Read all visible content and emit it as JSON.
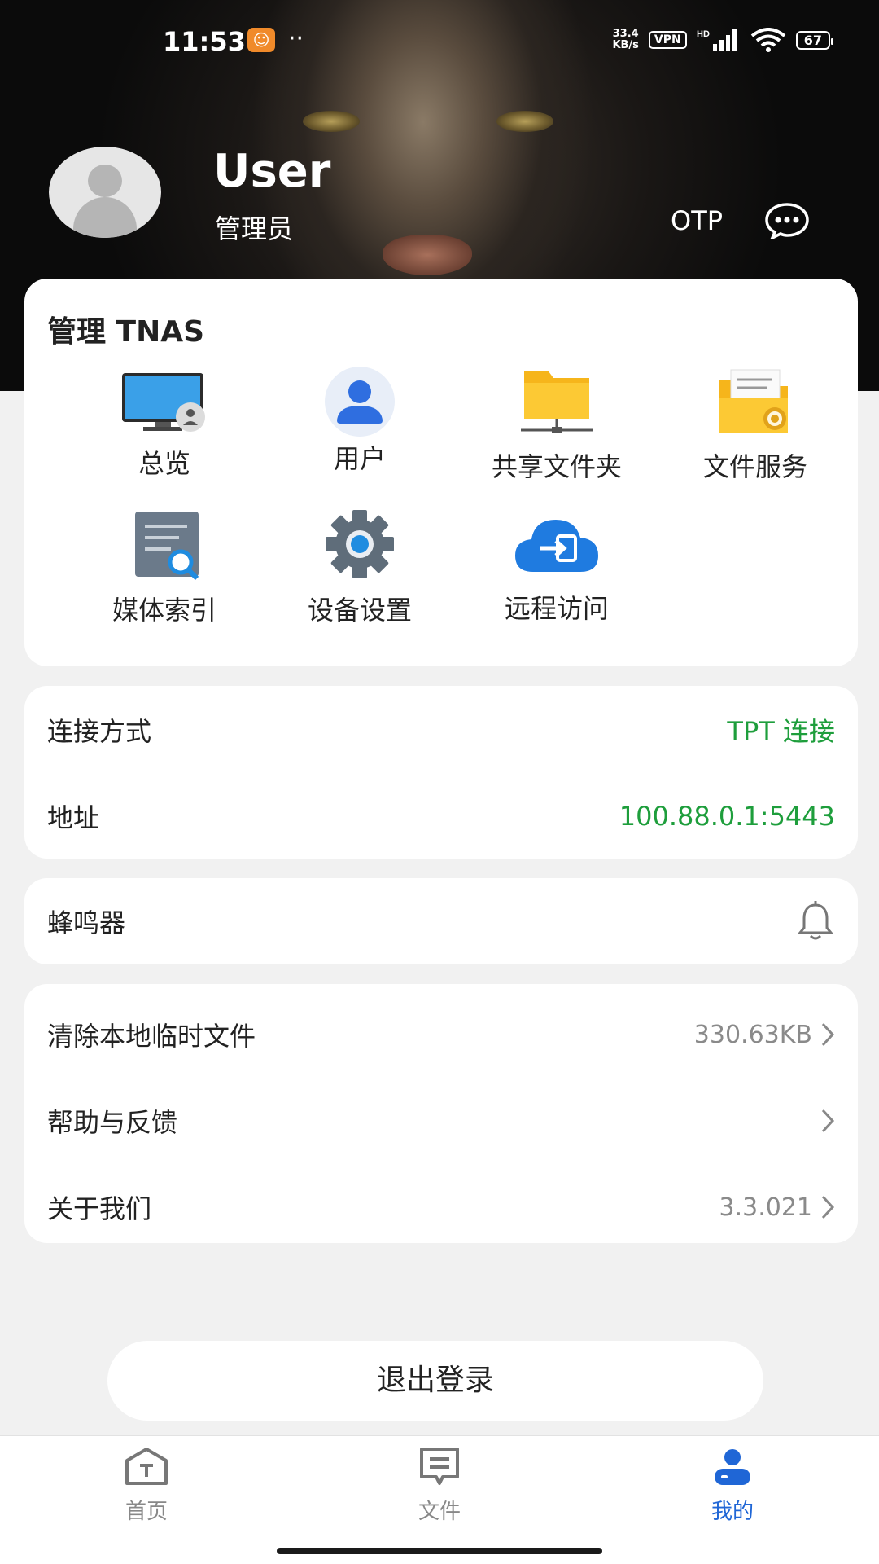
{
  "status_bar": {
    "time": "11:53",
    "app_badge": "☺",
    "more": "··",
    "speed_value": "33.4",
    "speed_unit": "KB/s",
    "vpn": "VPN",
    "signal_label": "HD",
    "battery": "67"
  },
  "profile": {
    "name": "User",
    "role": "管理员",
    "otp": "OTP"
  },
  "manage": {
    "title": "管理 TNAS",
    "tiles": [
      {
        "label": "总览",
        "icon": "monitor-icon"
      },
      {
        "label": "用户",
        "icon": "user-icon"
      },
      {
        "label": "共享文件夹",
        "icon": "shared-folder-icon"
      },
      {
        "label": "文件服务",
        "icon": "file-service-icon"
      },
      {
        "label": "媒体索引",
        "icon": "media-index-icon"
      },
      {
        "label": "设备设置",
        "icon": "gear-icon"
      },
      {
        "label": "远程访问",
        "icon": "cloud-access-icon"
      }
    ]
  },
  "connection": {
    "method_label": "连接方式",
    "method_value": "TPT 连接",
    "address_label": "地址",
    "address_value": "100.88.0.1:5443"
  },
  "buzzer": {
    "label": "蜂鸣器",
    "icon": "bell-icon"
  },
  "settings": {
    "clear_label": "清除本地临时文件",
    "clear_value": "330.63KB",
    "help_label": "帮助与反馈",
    "about_label": "关于我们",
    "about_value": "3.3.021"
  },
  "logout": "退出登录",
  "tabs": [
    {
      "label": "首页",
      "icon": "home-icon"
    },
    {
      "label": "文件",
      "icon": "files-icon"
    },
    {
      "label": "我的",
      "icon": "profile-icon"
    }
  ],
  "colors": {
    "accent_green": "#1e9e3c",
    "accent_blue": "#1f66d6",
    "background": "#f1f1f1"
  }
}
